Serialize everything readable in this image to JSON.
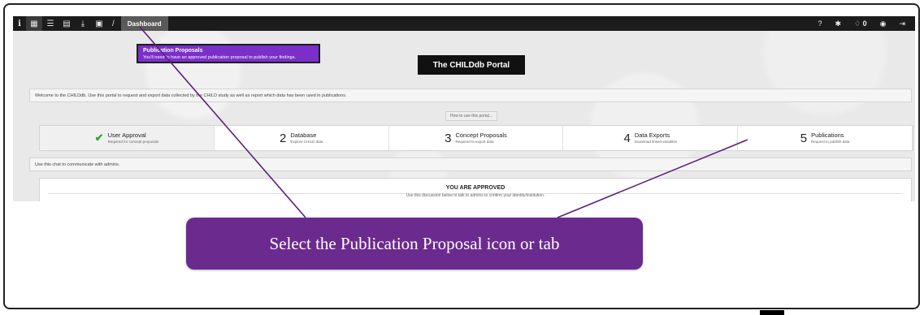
{
  "topbar": {
    "info_label": "i",
    "breadcrumb_sep": "/",
    "breadcrumb": "Dashboard",
    "notifications_count": "0"
  },
  "tooltip": {
    "title": "Publication Proposals",
    "text": "You'll need to have an approved publication proposal to publish your findings."
  },
  "portal_title": "The CHILDdb Portal",
  "welcome_text": "Welcome to the CHILDdb. Use this portal to request and export data collected by the CHILD study as well as report which data has been used in publications.",
  "howto_label": "How to use this portal...",
  "steps": [
    {
      "num": "",
      "title": "User Approval",
      "sub": "Required for concept proposals"
    },
    {
      "num": "2",
      "title": "Database",
      "sub": "Explore CHILD data"
    },
    {
      "num": "3",
      "title": "Concept Proposals",
      "sub": "Required to export data"
    },
    {
      "num": "4",
      "title": "Data Exports",
      "sub": "Download linked variables"
    },
    {
      "num": "5",
      "title": "Publications",
      "sub": "Request to publish data"
    }
  ],
  "chat_note": "Use this chat to communicate with admins.",
  "approved": {
    "title": "YOU ARE APPROVED",
    "sub": "Use this discussion below to talk to admins to confirm your identity/institution."
  },
  "callout_text": "Select the Publication Proposal icon or tab",
  "colors": {
    "topbar": "#1c1c1c",
    "tooltip": "#7b2fc9",
    "callout": "#6b2a8e",
    "check": "#36a43a"
  }
}
